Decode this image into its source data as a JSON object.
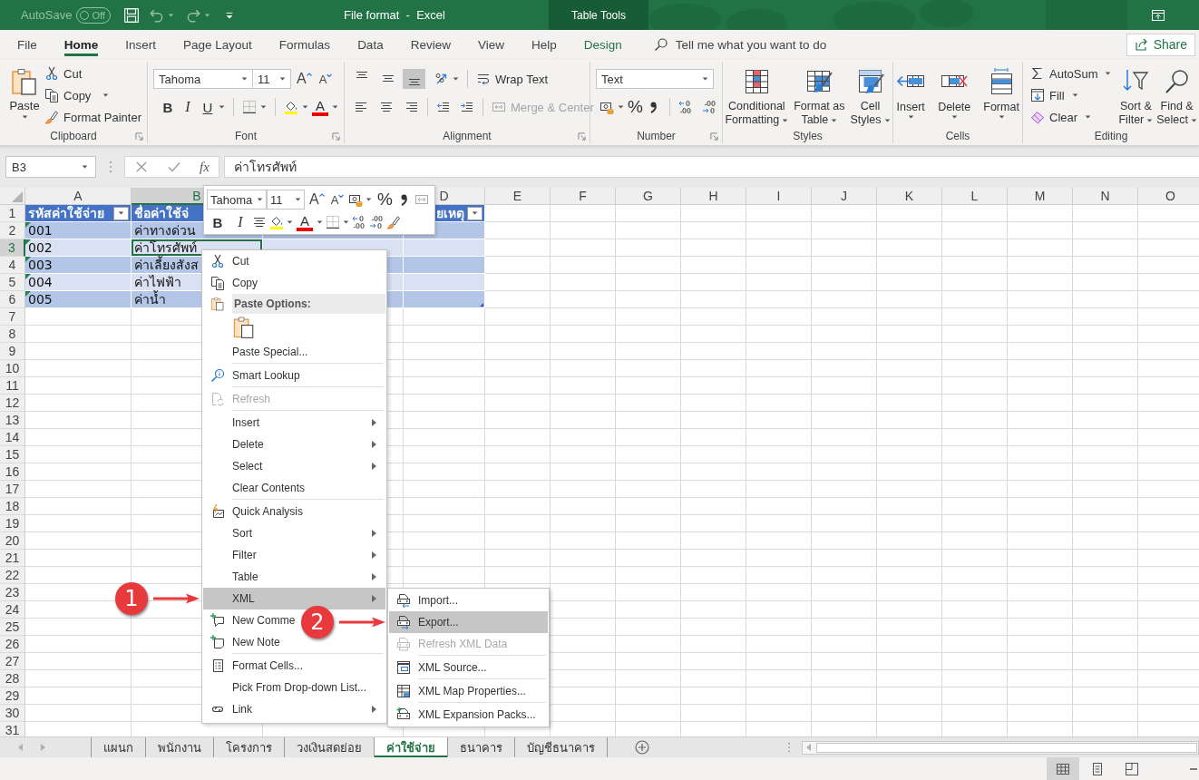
{
  "title_bar": {
    "autosave_label": "AutoSave",
    "autosave": {
      "on": false,
      "text": "Off"
    },
    "title": "File format  -  Excel",
    "context_tab": "Table Tools"
  },
  "ribbon_tabs": [
    {
      "label": "File",
      "kind": "standard",
      "selected": false
    },
    {
      "label": "Home",
      "kind": "standard",
      "selected": true
    },
    {
      "label": "Insert",
      "kind": "standard",
      "selected": false
    },
    {
      "label": "Page Layout",
      "kind": "standard",
      "selected": false
    },
    {
      "label": "Formulas",
      "kind": "standard",
      "selected": false
    },
    {
      "label": "Data",
      "kind": "standard",
      "selected": false
    },
    {
      "label": "Review",
      "kind": "standard",
      "selected": false
    },
    {
      "label": "View",
      "kind": "standard",
      "selected": false
    },
    {
      "label": "Help",
      "kind": "standard",
      "selected": false
    },
    {
      "label": "Design",
      "kind": "contextual",
      "selected": false
    }
  ],
  "tell_me": {
    "placeholder": "Tell me what you want to do"
  },
  "share_button": "Share",
  "clipboard": {
    "label": "Clipboard",
    "paste": "Paste",
    "cut": "Cut",
    "copy": "Copy",
    "format_painter": "Format Painter"
  },
  "font": {
    "label": "Font",
    "font_name": "Tahoma",
    "font_size": "11",
    "grow": "A",
    "shrink": "A",
    "bold": "B",
    "italic": "I",
    "underline": "U",
    "font_color": "A"
  },
  "alignment": {
    "label": "Alignment",
    "vertical": [
      {
        "selected": false
      },
      {
        "selected": false
      },
      {
        "selected": true
      }
    ],
    "wrap_text": "Wrap Text",
    "merge_center": {
      "label": "Merge & Center",
      "disabled": true
    }
  },
  "number": {
    "label": "Number",
    "format": "Text",
    "percent": "%"
  },
  "styles": {
    "label": "Styles",
    "buttons": [
      {
        "lines": [
          "Conditional",
          "Formatting"
        ]
      },
      {
        "lines": [
          "Format as",
          "Table"
        ]
      },
      {
        "lines": [
          "Cell",
          "Styles"
        ]
      }
    ]
  },
  "cells": {
    "label": "Cells",
    "buttons": [
      "Insert",
      "Delete",
      "Format"
    ]
  },
  "editing": {
    "label": "Editing",
    "autosum": "AutoSum",
    "fill": "Fill",
    "clear": "Clear",
    "sort_filter": [
      "Sort &",
      "Filter"
    ],
    "find_select": [
      "Find &",
      "Select"
    ]
  },
  "formula_bar": {
    "name_box": "B3",
    "function_label": "fx",
    "value": "ค่าโทรศัพท์"
  },
  "grid": {
    "columns": [
      {
        "letter": "A",
        "selected": false
      },
      {
        "letter": "B",
        "selected": true
      },
      {
        "letter": "D",
        "selected": false
      },
      {
        "letter": "E",
        "selected": false
      },
      {
        "letter": "F",
        "selected": false
      },
      {
        "letter": "G",
        "selected": false
      },
      {
        "letter": "H",
        "selected": false
      },
      {
        "letter": "I",
        "selected": false
      },
      {
        "letter": "J",
        "selected": false
      },
      {
        "letter": "K",
        "selected": false
      },
      {
        "letter": "L",
        "selected": false
      },
      {
        "letter": "M",
        "selected": false
      },
      {
        "letter": "N",
        "selected": false
      },
      {
        "letter": "O",
        "selected": false
      }
    ],
    "rows": [
      {
        "number": "1",
        "selected": false
      },
      {
        "number": "2",
        "selected": false
      },
      {
        "number": "3",
        "selected": true
      },
      {
        "number": "4",
        "selected": false
      },
      {
        "number": "5",
        "selected": false
      },
      {
        "number": "6",
        "selected": false
      },
      {
        "number": "7",
        "selected": false
      },
      {
        "number": "8",
        "selected": false
      },
      {
        "number": "9",
        "selected": false
      },
      {
        "number": "10",
        "selected": false
      },
      {
        "number": "11",
        "selected": false
      },
      {
        "number": "12",
        "selected": false
      },
      {
        "number": "13",
        "selected": false
      },
      {
        "number": "14",
        "selected": false
      },
      {
        "number": "15",
        "selected": false
      },
      {
        "number": "16",
        "selected": false
      },
      {
        "number": "17",
        "selected": false
      },
      {
        "number": "18",
        "selected": false
      },
      {
        "number": "19",
        "selected": false
      },
      {
        "number": "20",
        "selected": false
      },
      {
        "number": "21",
        "selected": false
      },
      {
        "number": "22",
        "selected": false
      },
      {
        "number": "23",
        "selected": false
      },
      {
        "number": "24",
        "selected": false
      },
      {
        "number": "25",
        "selected": false
      },
      {
        "number": "26",
        "selected": false
      },
      {
        "number": "27",
        "selected": false
      },
      {
        "number": "28",
        "selected": false
      },
      {
        "number": "29",
        "selected": false
      },
      {
        "number": "30",
        "selected": false
      },
      {
        "number": "31",
        "selected": false
      }
    ]
  },
  "table": {
    "header": [
      {
        "text": "รหัสค่าใช้จ่าย",
        "filter": true
      },
      {
        "text": "ชื่อค่าใช้จ่",
        "filter": false
      },
      {
        "text": "ยเหตุ",
        "filter": true
      }
    ],
    "rows": [
      {
        "code": "001",
        "name": "ค่าทางด่วน",
        "flagged": true
      },
      {
        "code": "002",
        "name": "ค่าโทรศัพท์",
        "flagged": true
      },
      {
        "code": "003",
        "name": "ค่าเลี้ยงสังส",
        "flagged": true
      },
      {
        "code": "004",
        "name": "ค่าไฟฟ้า",
        "flagged": true
      },
      {
        "code": "005",
        "name": "ค่าน้ำ",
        "flagged": true
      }
    ]
  },
  "mini_toolbar": {
    "font_name": "Tahoma",
    "font_size": "11",
    "grow": "A",
    "shrink": "A",
    "percent": "%",
    "bold": "B",
    "italic": "I",
    "font_color": "A"
  },
  "context_menu": {
    "items": [
      {
        "kind": "item",
        "label": "Cut",
        "selected": false,
        "disabled": false,
        "submenu": false
      },
      {
        "kind": "item",
        "label": "Copy",
        "selected": false,
        "disabled": false,
        "submenu": false
      },
      {
        "kind": "heading",
        "label": "Paste Options:"
      },
      {
        "kind": "paste_buttons"
      },
      {
        "kind": "item",
        "label": "Paste Special...",
        "selected": false,
        "disabled": false,
        "submenu": false
      },
      {
        "kind": "separator"
      },
      {
        "kind": "item",
        "label": "Smart Lookup",
        "selected": false,
        "disabled": false,
        "submenu": false
      },
      {
        "kind": "separator"
      },
      {
        "kind": "item",
        "label": "Refresh",
        "selected": false,
        "disabled": true,
        "submenu": false
      },
      {
        "kind": "separator"
      },
      {
        "kind": "item",
        "label": "Insert",
        "selected": false,
        "disabled": false,
        "submenu": true
      },
      {
        "kind": "item",
        "label": "Delete",
        "selected": false,
        "disabled": false,
        "submenu": true
      },
      {
        "kind": "item",
        "label": "Select",
        "selected": false,
        "disabled": false,
        "submenu": true
      },
      {
        "kind": "item",
        "label": "Clear Contents",
        "selected": false,
        "disabled": false,
        "submenu": false
      },
      {
        "kind": "separator"
      },
      {
        "kind": "item",
        "label": "Quick Analysis",
        "selected": false,
        "disabled": false,
        "submenu": false
      },
      {
        "kind": "item",
        "label": "Sort",
        "selected": false,
        "disabled": false,
        "submenu": true
      },
      {
        "kind": "item",
        "label": "Filter",
        "selected": false,
        "disabled": false,
        "submenu": true
      },
      {
        "kind": "item",
        "label": "Table",
        "selected": false,
        "disabled": false,
        "submenu": true
      },
      {
        "kind": "item",
        "label": "XML",
        "selected": true,
        "disabled": false,
        "submenu": true,
        "callout": "1"
      },
      {
        "kind": "item",
        "label": "New Comme",
        "selected": false,
        "disabled": false,
        "submenu": false
      },
      {
        "kind": "item",
        "label": "New Note",
        "selected": false,
        "disabled": false,
        "submenu": false
      },
      {
        "kind": "separator"
      },
      {
        "kind": "item",
        "label": "Format Cells...",
        "selected": false,
        "disabled": false,
        "submenu": false
      },
      {
        "kind": "item",
        "label": "Pick From Drop-down List...",
        "selected": false,
        "disabled": false,
        "submenu": false
      },
      {
        "kind": "item",
        "label": "Link",
        "selected": false,
        "disabled": false,
        "submenu": true
      }
    ]
  },
  "xml_submenu": {
    "items": [
      {
        "kind": "item",
        "label": "Import...",
        "selected": false,
        "disabled": false
      },
      {
        "kind": "item",
        "label": "Export...",
        "selected": true,
        "disabled": false,
        "callout": "2"
      },
      {
        "kind": "item",
        "label": "Refresh XML Data",
        "selected": false,
        "disabled": true
      },
      {
        "kind": "separator"
      },
      {
        "kind": "item",
        "label": "XML Source...",
        "selected": false,
        "disabled": false
      },
      {
        "kind": "separator"
      },
      {
        "kind": "item",
        "label": "XML Map Properties...",
        "selected": false,
        "disabled": false
      },
      {
        "kind": "separator"
      },
      {
        "kind": "item",
        "label": "XML Expansion Packs...",
        "selected": false,
        "disabled": false
      }
    ]
  },
  "sheet_tabs": [
    {
      "label": "แผนก",
      "selected": false
    },
    {
      "label": "พนักงาน",
      "selected": false
    },
    {
      "label": "โครงการ",
      "selected": false
    },
    {
      "label": "วงเงินสดย่อย",
      "selected": false
    },
    {
      "label": "ค่าใช้จ่าย",
      "selected": true
    },
    {
      "label": "ธนาคาร",
      "selected": false
    },
    {
      "label": "บัญชีธนาคาร",
      "selected": false
    }
  ],
  "status_bar": {
    "views": [
      {
        "selected": true
      },
      {
        "selected": false
      },
      {
        "selected": false
      }
    ]
  }
}
